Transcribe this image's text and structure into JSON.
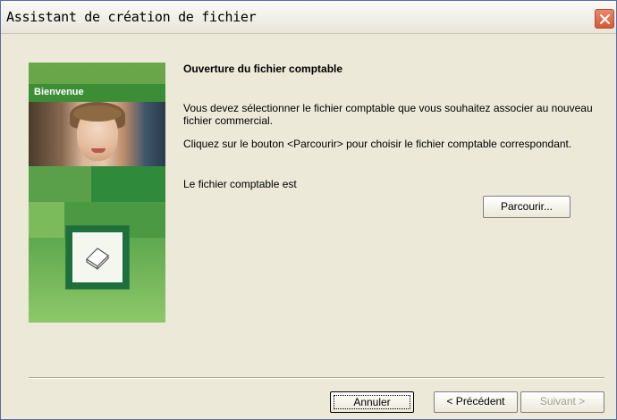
{
  "window": {
    "title": "Assistant de création de fichier",
    "close_icon": "close-icon"
  },
  "side": {
    "badge": "Bienvenue",
    "image": "welcome-photo",
    "icon": "document-icon"
  },
  "content": {
    "heading": "Ouverture du fichier comptable",
    "paragraph1": "Vous devez sélectionner le fichier comptable que vous souhaitez associer au nouveau fichier commercial.",
    "paragraph2": "Cliquez sur le bouton <Parcourir> pour choisir le fichier comptable correspondant.",
    "paragraph3": "Le fichier comptable est"
  },
  "buttons": {
    "browse_label": "Parcourir...",
    "cancel_label": "Annuler",
    "previous_label": "< Précédent",
    "next_label": "Suivant >"
  },
  "colors": {
    "accent_green": "#3b8f37",
    "close_red": "#d35a36"
  }
}
